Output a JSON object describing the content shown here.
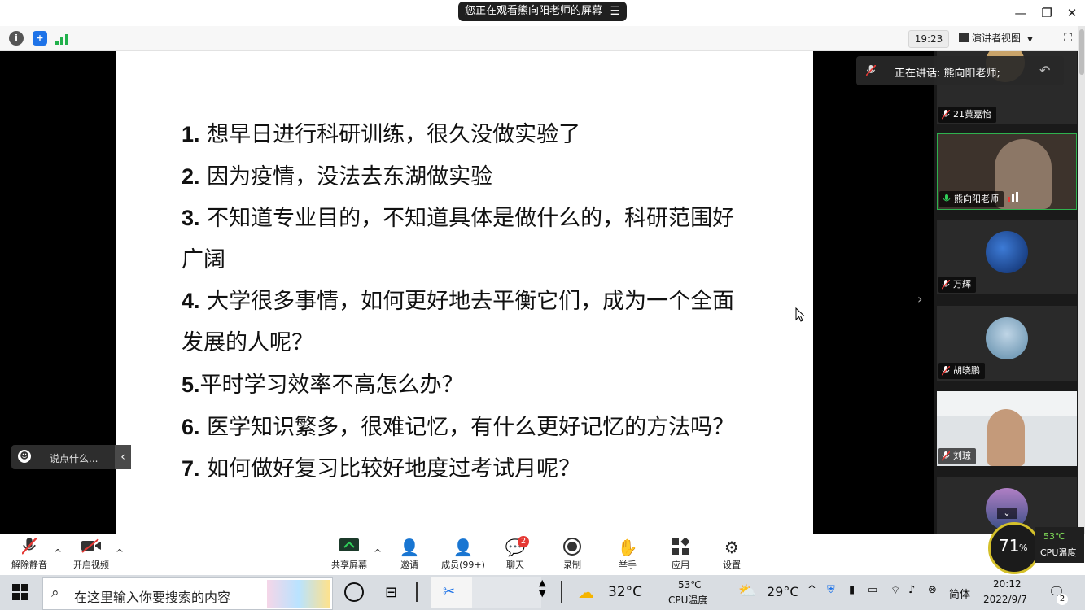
{
  "title_bar": {
    "share_label": "您正在观看熊向阳老师的屏幕",
    "menu_icon": "menu-icon",
    "controls": [
      "minimize-icon",
      "restore-icon",
      "close-icon"
    ]
  },
  "info_bar": {
    "time": "19:23",
    "view_label": "演讲者视图",
    "icons": [
      "info-icon",
      "shield-icon",
      "signal-icon",
      "fullscreen-icon"
    ]
  },
  "slide": {
    "items": [
      {
        "num": "1.",
        "text": " 想早日进行科研训练，很久没做实验了"
      },
      {
        "num": "2.",
        "text": " 因为疫情，没法去东湖做实验"
      },
      {
        "num": "3.",
        "text": " 不知道专业目的，不知道具体是做什么的，科研范围好"
      },
      {
        "num": "",
        "text": "广阔"
      },
      {
        "num": "4.",
        "text": " 大学很多事情，如何更好地去平衡它们，成为一个全面"
      },
      {
        "num": "",
        "text": "发展的人呢？"
      },
      {
        "num": "5.",
        "text": "平时学习效率不高怎么办？"
      },
      {
        "num": "6.",
        "text": " 医学知识繁多，很难记忆，有什么更好记忆的方法吗？"
      },
      {
        "num": "7.",
        "text": " 如何做好复习比较好地度过考试月呢？"
      }
    ]
  },
  "speaking": {
    "label": "正在讲话: 熊向阳老师;"
  },
  "participants": [
    {
      "name": "21黄嘉怡",
      "muted": true
    },
    {
      "name": "熊向阳老师",
      "muted": false
    },
    {
      "name": "万辉",
      "muted": true
    },
    {
      "name": "胡晓鹏",
      "muted": true
    },
    {
      "name": "刘琼",
      "muted": true
    }
  ],
  "chat": {
    "placeholder": "说点什么..."
  },
  "toolbar": {
    "unmute": "解除静音",
    "video": "开启视频",
    "share": "共享屏幕",
    "invite": "邀请",
    "members": "成员(99+)",
    "chat": "聊天",
    "chat_badge": "2",
    "record": "录制",
    "raise_hand": "举手",
    "apps": "应用",
    "settings": "设置"
  },
  "cpu_widget": {
    "percent": "71",
    "percent_unit": "%",
    "temp": "53℃",
    "label": "CPU温度"
  },
  "taskbar": {
    "search_placeholder": "在这里输入你要搜索的内容",
    "weather1_temp": "32°C",
    "cpu_temp": "53℃",
    "cpu_label": "CPU温度",
    "weather2_temp": "29°C",
    "ime": "简体",
    "time": "20:12",
    "date": "2022/9/7",
    "notification_count": "2"
  }
}
